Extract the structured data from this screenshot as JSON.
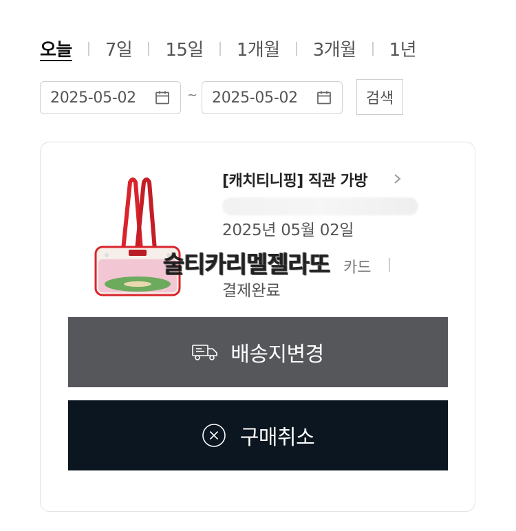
{
  "period_tabs": [
    {
      "label": "오늘",
      "active": true
    },
    {
      "label": "7일"
    },
    {
      "label": "15일"
    },
    {
      "label": "1개월"
    },
    {
      "label": "3개월"
    },
    {
      "label": "1년"
    }
  ],
  "date_range": {
    "start": "2025-05-02",
    "separator": "~",
    "end": "2025-05-02",
    "icon": "calendar-icon"
  },
  "search_button": {
    "label": "검색"
  },
  "order": {
    "product_name": "[캐치티니핑] 직관 가방",
    "product_image_alt": "bag-image",
    "order_date": "2025년 05월 02일",
    "payment_method": "카드",
    "status": "결제완료",
    "watermark": "술티카리멜젤라또"
  },
  "actions": {
    "change_address": {
      "label": "배송지변경",
      "icon": "truck-icon"
    },
    "cancel": {
      "label": "구매취소",
      "icon": "x-circle-icon"
    }
  },
  "colors": {
    "address_button_bg": "#56575b",
    "cancel_button_bg": "#0b1620",
    "bag_red": "#d9242c",
    "bag_cream": "#f6eee8",
    "bag_pink": "#f3c6d4",
    "bag_green": "#6cab5e"
  }
}
